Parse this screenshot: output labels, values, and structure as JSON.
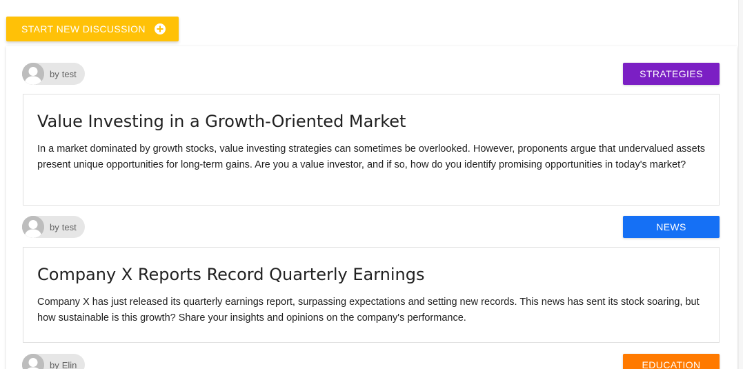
{
  "toolbar": {
    "new_discussion_label": "START NEW DISCUSSION",
    "new_discussion_icon": "plus-circle-icon",
    "accent_color": "#FFC107"
  },
  "posts": [
    {
      "author_prefix": "by",
      "author": "test",
      "category": "STRATEGIES",
      "category_color": "#7B1FC4",
      "title": "Value Investing in a Growth-Oriented Market",
      "body": "In a market dominated by growth stocks, value investing strategies can sometimes be overlooked. However, proponents argue that undervalued assets present unique opportunities for long-term gains. Are you a value investor, and if so, how do you identify promising opportunities in today's market?"
    },
    {
      "author_prefix": "by",
      "author": "test",
      "category": "NEWS",
      "category_color": "#1570F5",
      "title": "Company X Reports Record Quarterly Earnings",
      "body": "Company X has just released its quarterly earnings report, surpassing expectations and setting new records. This news has sent its stock soaring, but how sustainable is this growth? Share your insights and opinions on the company's performance."
    },
    {
      "author_prefix": "by",
      "author": "Elin",
      "category": "EDUCATION",
      "category_color": "#FF7A00",
      "title": "",
      "body": ""
    }
  ]
}
